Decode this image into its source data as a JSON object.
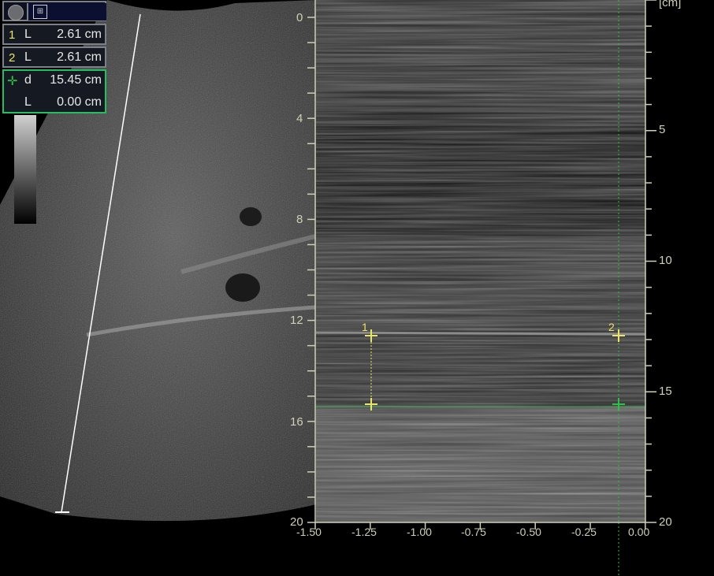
{
  "measurements": [
    {
      "index": "1",
      "type": "L",
      "value": "2.61 cm"
    },
    {
      "index": "2",
      "type": "L",
      "value": "2.61 cm"
    }
  ],
  "active_measurement": {
    "distance_type": "d",
    "distance": "15.45 cm",
    "length_type": "L",
    "length": "0.00 cm"
  },
  "markers": {
    "one": "1",
    "two": "2"
  },
  "bmode_depth_labels": [
    "0",
    "4",
    "8",
    "12",
    "16",
    "20"
  ],
  "mmode_depth_labels": [
    "5",
    "10",
    "15",
    "20"
  ],
  "unit_label": "[cm]",
  "time_axis_labels": [
    "-1.50",
    "-1.25",
    "-1.00",
    "-0.75",
    "-0.50",
    "-0.25",
    "0.00"
  ],
  "colors": {
    "accent": "#e9e46a",
    "active": "#22c060",
    "axis": "#cfcfb7"
  }
}
